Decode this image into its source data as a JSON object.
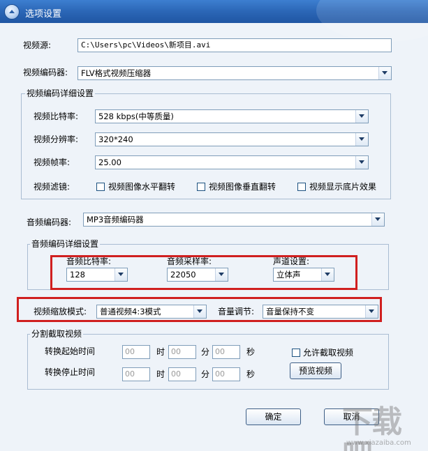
{
  "window": {
    "title": "选项设置"
  },
  "source": {
    "label": "视频源:",
    "value": "C:\\Users\\pc\\Videos\\新项目.avi"
  },
  "video_encoder": {
    "label": "视频编码器:",
    "value": "FLV格式视频压缩器"
  },
  "video_detail": {
    "group_title": "视频编码详细设置",
    "bitrate": {
      "label": "视频比特率:",
      "value": "528 kbps(中等质量)"
    },
    "resolution": {
      "label": "视频分辨率:",
      "value": "320*240"
    },
    "framerate": {
      "label": "视频帧率:",
      "value": "25.00"
    },
    "filter": {
      "label": "视频滤镜:",
      "hflip": "视频图像水平翻转",
      "vflip": "视频图像垂直翻转",
      "negative": "视频显示底片效果"
    }
  },
  "audio_encoder": {
    "label": "音频编码器:",
    "value": "MP3音频编码器"
  },
  "audio_detail": {
    "group_title": "音频编码详细设置",
    "bitrate": {
      "label": "音频比特率:",
      "value": "128"
    },
    "samplerate": {
      "label": "音频采样率:",
      "value": "22050"
    },
    "channel": {
      "label": "声道设置:",
      "value": "立体声"
    }
  },
  "scaling": {
    "label": "视频缩放模式:",
    "value": "普通视频4:3模式"
  },
  "volume": {
    "label": "音量调节:",
    "value": "音量保持不变"
  },
  "clip": {
    "group_title": "分割截取视频",
    "start_label": "转换起始时间",
    "end_label": "转换停止时间",
    "placeholder": "00",
    "hour": "时",
    "minute": "分",
    "second": "秒",
    "allow": "允许截取视频",
    "preview": "预览视频"
  },
  "buttons": {
    "ok": "确定",
    "cancel": "取消"
  },
  "watermark": {
    "text": "下载吧",
    "sub": "www.xiazaiba.com"
  },
  "colors": {
    "titlebar": "#2b66b6",
    "panel": "#eef3f9",
    "highlight": "#d01f1f"
  }
}
